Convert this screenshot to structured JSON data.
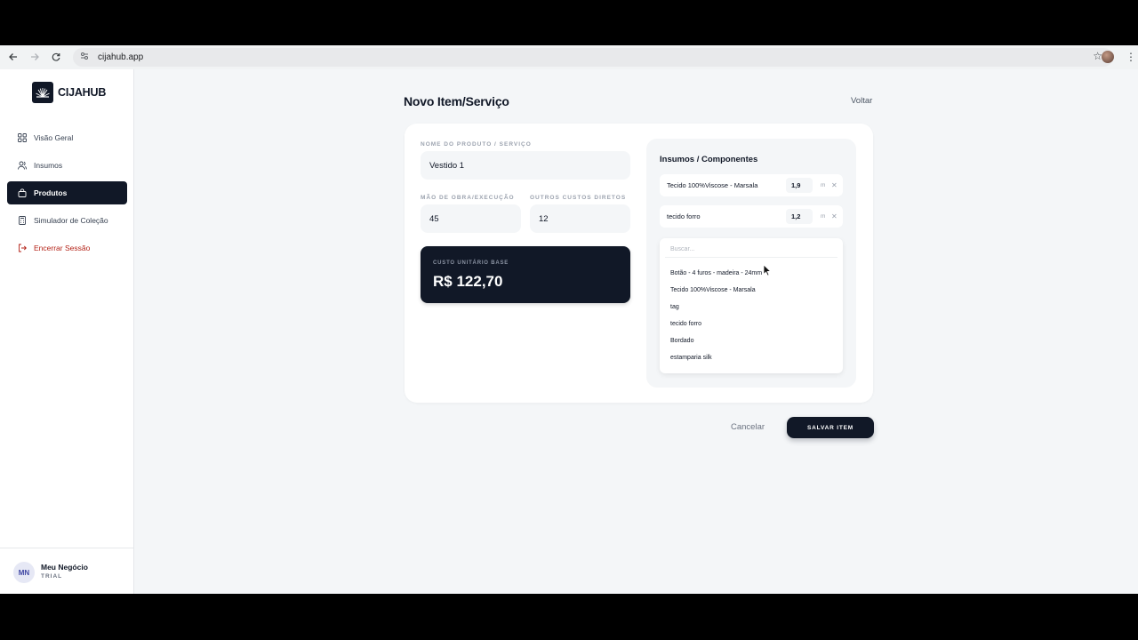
{
  "browser": {
    "url": "cijahub.app",
    "icons": {
      "back": "arrow-left-icon",
      "forward": "arrow-right-icon",
      "reload": "reload-icon",
      "site_settings": "tune-icon",
      "bookmark": "star-icon",
      "menu": "kebab-icon"
    }
  },
  "sidebar": {
    "brand": "CIJAHUB",
    "items": [
      {
        "label": "Visão Geral",
        "icon": "grid-icon",
        "active": false
      },
      {
        "label": "Insumos",
        "icon": "users-icon",
        "active": false
      },
      {
        "label": "Produtos",
        "icon": "bag-icon",
        "active": true
      },
      {
        "label": "Simulador de Coleção",
        "icon": "calculator-icon",
        "active": false
      },
      {
        "label": "Encerrar Sessão",
        "icon": "logout-icon",
        "active": false
      }
    ],
    "user": {
      "initials": "MN",
      "name": "Meu Negócio",
      "plan": "TRIAL"
    }
  },
  "page": {
    "title": "Novo Item/Serviço",
    "back": "Voltar"
  },
  "form": {
    "name_label": "NOME DO PRODUTO / SERVIÇO",
    "name_value": "Vestido 1",
    "labor_label": "MÃO DE OBRA/EXECUÇÃO",
    "labor_value": "45",
    "other_label": "OUTROS CUSTOS DIRETOS",
    "other_value": "12",
    "cost_label": "CUSTO UNITÁRIO BASE",
    "cost_value": "R$ 122,70"
  },
  "components": {
    "title": "Insumos / Componentes",
    "items": [
      {
        "name": "Tecido 100%Viscose - Marsala",
        "qty": "1,9",
        "unit": "m"
      },
      {
        "name": "tecido forro",
        "qty": "1,2",
        "unit": "m"
      }
    ],
    "search_placeholder": "Buscar...",
    "options": [
      "Botão - 4 furos - madeira - 24mm",
      "Tecido 100%Viscose - Marsala",
      "tag",
      "tecido forro",
      "Bordado",
      "estamparia silk"
    ]
  },
  "actions": {
    "cancel": "Cancelar",
    "save": "SALVAR ITEM"
  },
  "colors": {
    "primary": "#111827",
    "danger": "#b42318",
    "background": "#f4f6f8"
  }
}
